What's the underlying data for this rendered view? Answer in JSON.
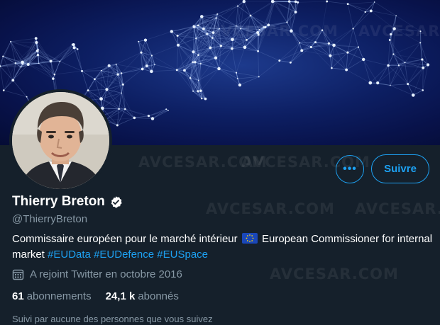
{
  "watermark": {
    "text": "AVCESAR.COM"
  },
  "profile": {
    "name": "Thierry Breton",
    "handle": "@ThierryBreton",
    "bio_text": "Commissaire européen pour le marché intérieur",
    "bio_text_2": "European Commissioner for internal market",
    "hashtags": [
      "#EUData",
      "#EUDefence",
      "#EUSpace"
    ],
    "joined": "A rejoint Twitter en octobre 2016",
    "following_count": "61",
    "following_label": "abonnements",
    "followers_count": "24,1 k",
    "followers_label": "abonnés",
    "followed_by": "Suivi par aucune des personnes que vous suivez"
  },
  "actions": {
    "more_label": "•••",
    "follow_label": "Suivre"
  },
  "colors": {
    "background": "#15202b",
    "accent": "#1da1f2",
    "muted": "#8899a6"
  },
  "icons": {
    "verified": "verified-badge-icon",
    "calendar": "calendar-icon",
    "flag": "eu-flag-icon"
  }
}
